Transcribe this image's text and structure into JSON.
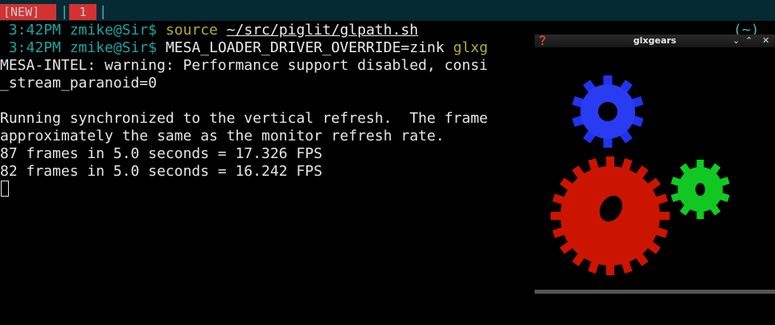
{
  "tabs": {
    "first": "[NEW]",
    "second": "1",
    "separator": "|"
  },
  "terminal": {
    "lines": {
      "l1": {
        "time": "3:42PM",
        "prompt": "zmike@Sir$",
        "cmd": "source",
        "arg": "~/src/piglit/glpath.sh",
        "right": "(~)"
      },
      "l2": {
        "time": "3:42PM",
        "prompt": "zmike@Sir$",
        "cmd": "MESA_LOADER_DRIVER_OVERRIDE=zink",
        "arg": "glxg"
      },
      "l3": "MESA-INTEL: warning: Performance support disabled, consi",
      "l4": "_stream_paranoid=0",
      "l5": "Running synchronized to the vertical refresh.  The frame",
      "l6": "approximately the same as the monitor refresh rate.",
      "l7": "87 frames in 5.0 seconds = 17.326 FPS",
      "l8": "82 frames in 5.0 seconds = 16.242 FPS"
    }
  },
  "glxgears": {
    "title": "glxgears",
    "gears": [
      {
        "name": "blue-gear",
        "color": "#2233ee"
      },
      {
        "name": "red-gear",
        "color": "#cc1400"
      },
      {
        "name": "green-gear",
        "color": "#11cc22"
      }
    ]
  }
}
